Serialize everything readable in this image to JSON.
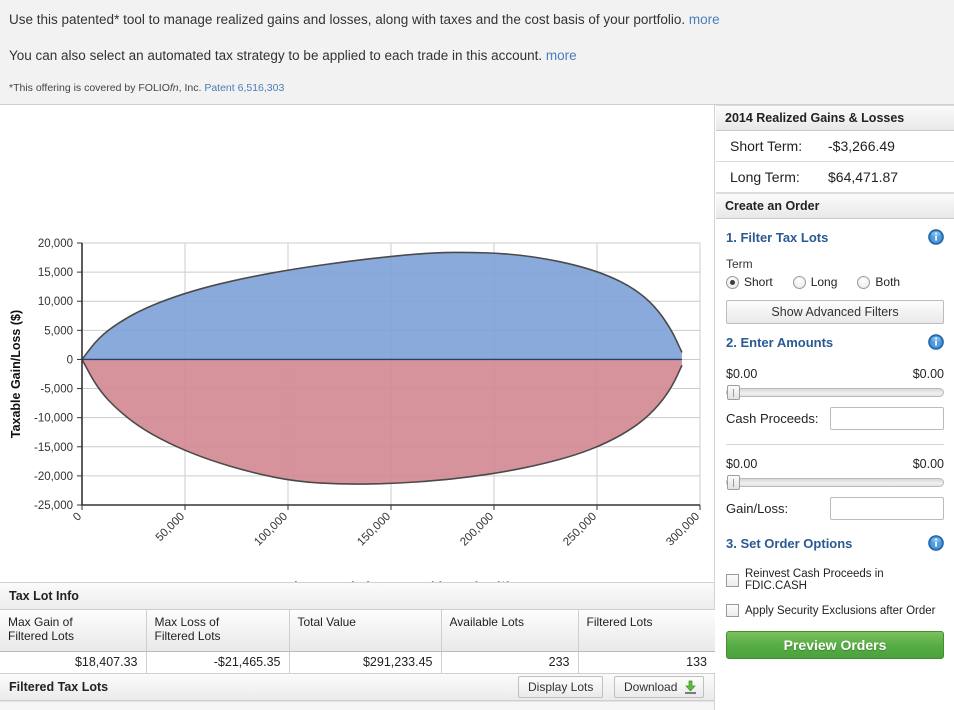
{
  "intro": {
    "line1_text": "Use this patented* tool to manage realized gains and losses, along with taxes and the cost basis of your portfolio.",
    "line1_link": "more",
    "line2_text": "You can also select an automated tax strategy to be applied to each trade in this account.",
    "line2_link": "more",
    "footnote_prefix": "*This offering is covered by FOLIO",
    "footnote_italic": "fn",
    "footnote_mid": ", Inc.",
    "footnote_link": "Patent 6,516,303"
  },
  "chart_data": {
    "type": "area",
    "title": "",
    "xlabel": "Cash Proceeds from Securities Sales ($)",
    "ylabel": "Taxable Gain/Loss ($)",
    "xlim": [
      0,
      300000
    ],
    "ylim": [
      -25000,
      20000
    ],
    "xticks": [
      "0",
      "50,000",
      "100,000",
      "150,000",
      "200,000",
      "250,000",
      "300,000"
    ],
    "xtick_values": [
      0,
      50000,
      100000,
      150000,
      200000,
      250000,
      300000
    ],
    "yticks": [
      "20,000",
      "15,000",
      "10,000",
      "5,000",
      "0",
      "-5,000",
      "-10,000",
      "-15,000",
      "-20,000",
      "-25,000"
    ],
    "ytick_values": [
      20000,
      15000,
      10000,
      5000,
      0,
      -5000,
      -10000,
      -15000,
      -20000,
      -25000
    ],
    "grid": true,
    "legend": "none",
    "colors": {
      "gain_fill": "#7fa3d8",
      "loss_fill": "#d48a92",
      "outline": "#4a4a4a"
    },
    "series": [
      {
        "name": "Max Gain of Filtered Lots",
        "color": "#7fa3d8",
        "x": [
          0,
          8000,
          18000,
          30000,
          45000,
          62000,
          82000,
          104000,
          128000,
          152000,
          172000,
          188000,
          205000,
          222000,
          240000,
          255000,
          268000,
          278000,
          286000,
          291233
        ],
        "values": [
          0,
          3700,
          6400,
          8700,
          10800,
          12600,
          14200,
          15600,
          16800,
          17800,
          18350,
          18407,
          18200,
          17500,
          16200,
          14500,
          12200,
          9200,
          5200,
          1200
        ]
      },
      {
        "name": "Max Loss of Filtered Lots",
        "color": "#d48a92",
        "x": [
          0,
          8000,
          18000,
          30000,
          45000,
          62000,
          82000,
          104000,
          128000,
          152000,
          172000,
          188000,
          205000,
          222000,
          240000,
          255000,
          268000,
          278000,
          286000,
          291233
        ],
        "values": [
          0,
          -5200,
          -8900,
          -12100,
          -14900,
          -17300,
          -19400,
          -21000,
          -21465,
          -21300,
          -20800,
          -20200,
          -19300,
          -18100,
          -16400,
          -14300,
          -11700,
          -8700,
          -5000,
          -1000
        ]
      }
    ]
  },
  "taxlot": {
    "section_title": "Tax Lot Info",
    "columns": [
      "Max Gain of\nFiltered Lots",
      "Max Loss of\nFiltered Lots",
      "Total Value",
      "Available Lots",
      "Filtered Lots"
    ],
    "col0_l1": "Max Gain of",
    "col0_l2": "Filtered Lots",
    "col1_l1": "Max Loss of",
    "col1_l2": "Filtered Lots",
    "col2": "Total Value",
    "col3": "Available Lots",
    "col4": "Filtered Lots",
    "row": [
      "$18,407.33",
      "-$21,465.35",
      "$291,233.45",
      "233",
      "133"
    ],
    "filtered_title": "Filtered Tax Lots",
    "display_lots_label": "Display Lots",
    "download_label": "Download"
  },
  "sidebar": {
    "gains_header": "2014 Realized Gains & Losses",
    "short_term_label": "Short Term:",
    "short_term_value": "-$3,266.49",
    "long_term_label": "Long Term:",
    "long_term_value": "$64,471.87",
    "order_header": "Create an Order",
    "step1_title": "1. Filter Tax Lots",
    "term_label": "Term",
    "radios": [
      {
        "label": "Short",
        "selected": true
      },
      {
        "label": "Long",
        "selected": false
      },
      {
        "label": "Both",
        "selected": false
      }
    ],
    "radio0": "Short",
    "radio1": "Long",
    "radio2": "Both",
    "advanced_filters_label": "Show Advanced Filters",
    "step2_title": "2. Enter Amounts",
    "cash_min": "$0.00",
    "cash_max": "$0.00",
    "cash_label": "Cash Proceeds:",
    "cash_value": "",
    "cash_placeholder": "",
    "gl_min": "$0.00",
    "gl_max": "$0.00",
    "gl_label": "Gain/Loss:",
    "gl_value": "",
    "gl_placeholder": "",
    "step3_title": "3. Set Order Options",
    "check1_label": "Reinvest Cash Proceeds in FDIC.CASH",
    "check2_label": "Apply Security Exclusions after Order",
    "preview_label": "Preview Orders"
  }
}
